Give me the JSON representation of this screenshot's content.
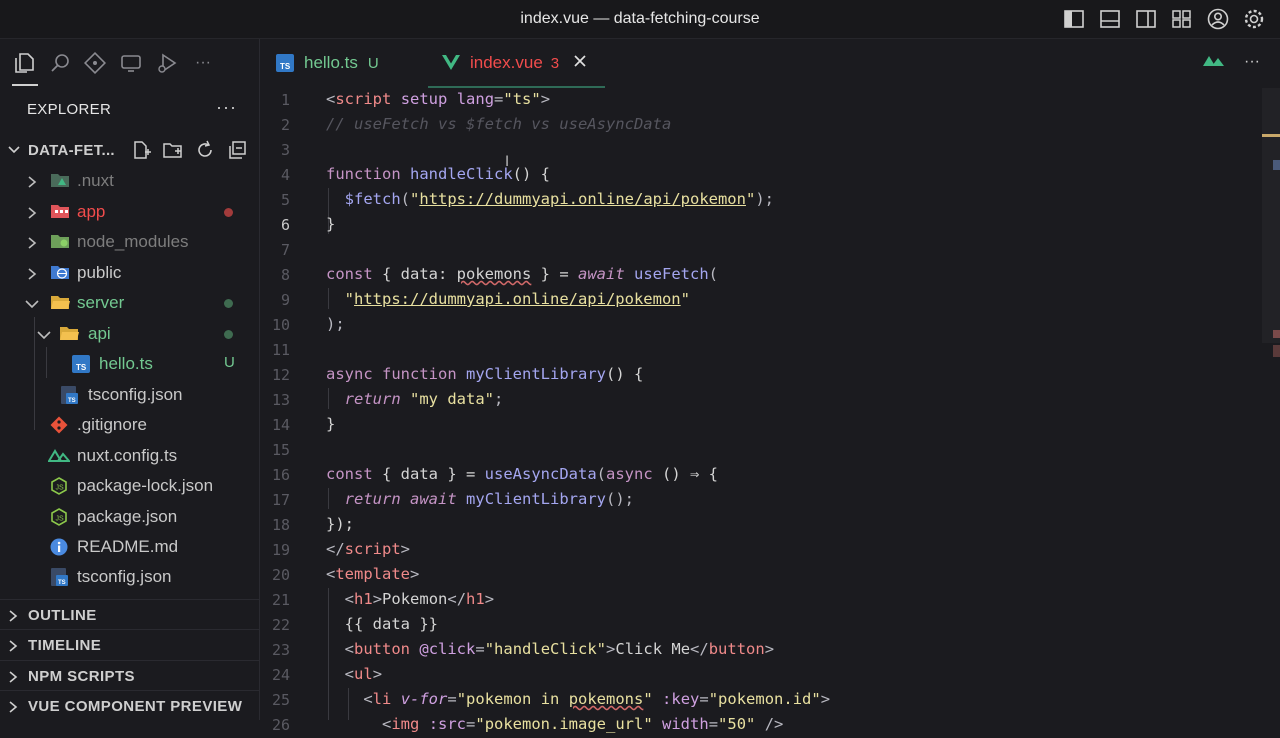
{
  "window": {
    "title": "index.vue — data-fetching-course"
  },
  "sidebar": {
    "explorer_title": "EXPLORER",
    "more": "···",
    "root_label": "DATA-FET...",
    "tree": [
      {
        "label": "node_nuxt",
        "name": ".nuxt",
        "color": "#7d7d7d"
      },
      {
        "label": "app",
        "color": "#f14c4c",
        "status": "dot-red"
      },
      {
        "label": "node_modules",
        "color": "#7d7d7d"
      },
      {
        "label": "public",
        "color": "#c9c9c9"
      },
      {
        "label": "server",
        "color": "#73c991",
        "status": "dot-green"
      },
      {
        "label": "api",
        "color": "#73c991",
        "status": "dot-green"
      },
      {
        "label": "hello.ts",
        "color": "#73c991",
        "status": "U"
      },
      {
        "label": "tsconfig.json",
        "color": "#c9c9c9"
      },
      {
        "label": ".gitignore",
        "color": "#c9c9c9"
      },
      {
        "label": "nuxt.config.ts",
        "color": "#c9c9c9"
      },
      {
        "label": "package-lock.json",
        "color": "#c9c9c9"
      },
      {
        "label": "package.json",
        "color": "#c9c9c9"
      },
      {
        "label": "README.md",
        "color": "#c9c9c9"
      },
      {
        "label": "tsconfig.json",
        "color": "#c9c9c9"
      }
    ],
    "sections": [
      "OUTLINE",
      "TIMELINE",
      "NPM SCRIPTS",
      "VUE COMPONENT PREVIEW"
    ]
  },
  "tabs": [
    {
      "label": "hello.ts",
      "badge": "U",
      "active": false
    },
    {
      "label": "index.vue",
      "badge": "3",
      "active": true
    }
  ],
  "editor": {
    "current_line": 6,
    "line_numbers": [
      "1",
      "2",
      "3",
      "4",
      "5",
      "6",
      "7",
      "8",
      "9",
      "10",
      "11",
      "12",
      "13",
      "14",
      "15",
      "16",
      "17",
      "18",
      "19",
      "20",
      "21",
      "22",
      "23",
      "24",
      "25",
      "26"
    ]
  },
  "code": {
    "l1_lt": "<",
    "l1_tag": "script",
    "l1_a1": "setup",
    "l1_a2": "lang",
    "l1_eq": "=",
    "l1_v": "\"ts\"",
    "l1_gt": ">",
    "l2_comment": "// useFetch vs $fetch vs useAsyncData",
    "l4_kw": "function",
    "l4_fn": "handleClick",
    "l4_rest": "() {",
    "l5_fn": "$fetch",
    "l5_p": "(",
    "l5_q1": "\"",
    "l5_url": "https://dummyapi.online/api/pokemon",
    "l5_q2": "\"",
    "l5_end": ");",
    "l6": "}",
    "l8_kw": "const",
    "l8_a": "{ data: ",
    "l8_var": "pokemons",
    "l8_b": " } = ",
    "l8_await": "await",
    "l8_fn": "useFetch",
    "l8_p": "(",
    "l9_q1": "\"",
    "l9_url": "https://dummyapi.online/api/pokemon",
    "l9_q2": "\"",
    "l10": ");",
    "l12_kw1": "async",
    "l12_kw2": "function",
    "l12_fn": "myClientLibrary",
    "l12_rest": "() {",
    "l13_kw": "return",
    "l13_str": "\"my data\"",
    "l13_end": ";",
    "l14": "}",
    "l16_kw": "const",
    "l16_a": "{ data } = ",
    "l16_fn": "useAsyncData",
    "l16_p": "(",
    "l16_kw2": "async",
    "l16_rest": " () ⇒ {",
    "l17_kw1": "return",
    "l17_kw2": "await",
    "l17_fn": "myClientLibrary",
    "l17_end": "();",
    "l18": "});",
    "l19_lt": "</",
    "l19_tag": "script",
    "l19_gt": ">",
    "l20_lt": "<",
    "l20_tag": "template",
    "l20_gt": ">",
    "l21_lt": "<",
    "l21_tag": "h1",
    "l21_gt": ">",
    "l21_text": "Pokemon",
    "l21_lt2": "</",
    "l21_tag2": "h1",
    "l21_gt2": ">",
    "l22": "{{ data }}",
    "l23_lt": "<",
    "l23_tag": "button",
    "l23_attr": "@click",
    "l23_eq": "=",
    "l23_v": "\"handleClick\"",
    "l23_gt": ">",
    "l23_text": "Click Me",
    "l23_lt2": "</",
    "l23_tag2": "button",
    "l23_gt2": ">",
    "l24_lt": "<",
    "l24_tag": "ul",
    "l24_gt": ">",
    "l25_lt": "<",
    "l25_tag": "li",
    "l25_attr": "v-for",
    "l25_eq": "=",
    "l25_q1": "\"pokemon in ",
    "l25_var": "pokemons",
    "l25_q2": "\"",
    "l25_attr2": ":key",
    "l25_eq2": "=",
    "l25_v2": "\"pokemon.id\"",
    "l25_gt": ">",
    "l26_lt": "<",
    "l26_tag": "img",
    "l26_attr": ":src",
    "l26_eq": "=",
    "l26_v": "\"pokemon.image_url\"",
    "l26_attr2": "width",
    "l26_eq2": "=",
    "l26_v2": "\"50\"",
    "l26_end": " />"
  },
  "colors": {
    "accent_vue": "#41b883",
    "modified_red": "#f14c4c",
    "untracked_green": "#73c991"
  }
}
